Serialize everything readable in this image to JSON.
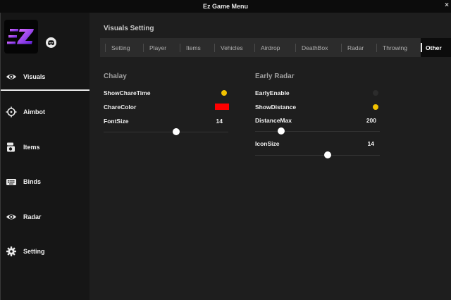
{
  "window": {
    "title": "Ez Game Menu",
    "close_glyph": "×"
  },
  "sidebar": {
    "logo_icon": "ez-logo",
    "discord_icon": "discord-icon",
    "items": [
      {
        "label": "Visuals",
        "icon": "eye-icon",
        "active": true
      },
      {
        "label": "Aimbot",
        "icon": "crosshair-icon",
        "active": false
      },
      {
        "label": "Items",
        "icon": "items-icon",
        "active": false
      },
      {
        "label": "Binds",
        "icon": "keyboard-icon",
        "active": false
      },
      {
        "label": "Radar",
        "icon": "eye-icon",
        "active": false
      },
      {
        "label": "Setting",
        "icon": "gear-icon",
        "active": false
      }
    ]
  },
  "main": {
    "title": "Visuals Setting",
    "tabs": [
      "Setting",
      "Player",
      "Items",
      "Vehicles",
      "Airdrop",
      "DeathBox",
      "Radar",
      "Throwing",
      "Other"
    ],
    "active_tab": "Other",
    "groups": [
      {
        "title": "Chalay",
        "rows": [
          {
            "label": "ShowChareTime",
            "type": "toggle",
            "on": true
          },
          {
            "label": "ChareColor",
            "type": "color",
            "color": "#ff0000"
          },
          {
            "label": "FontSize",
            "type": "slider",
            "value": "14",
            "fraction": 0.58
          }
        ]
      },
      {
        "title": "Early Radar",
        "rows": [
          {
            "label": "EarlyEnable",
            "type": "toggle",
            "on": false
          },
          {
            "label": "ShowDistance",
            "type": "toggle",
            "on": true
          },
          {
            "label": "DistanceMax",
            "type": "slider",
            "value": "200",
            "fraction": 0.21
          },
          {
            "label": "IconSize",
            "type": "slider",
            "value": "14",
            "fraction": 0.58
          }
        ]
      }
    ]
  },
  "colors": {
    "accent_toggle": "#f2c200",
    "background": "#1e1e1e",
    "sidebar": "#161616",
    "tabbar": "#2c2c2c"
  }
}
